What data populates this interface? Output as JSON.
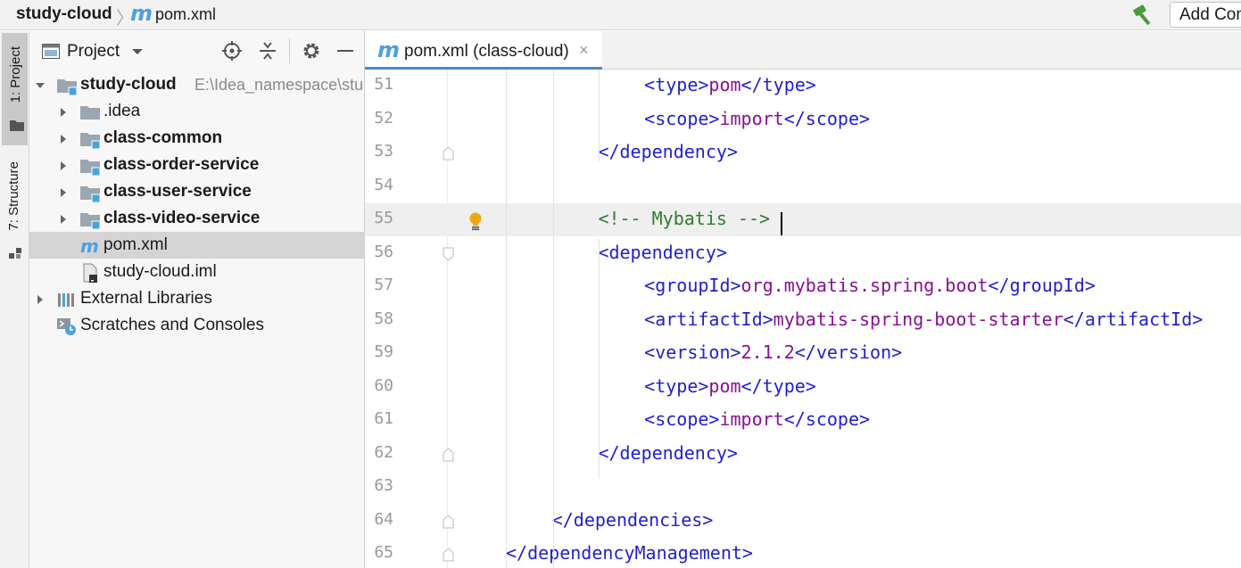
{
  "navbar": {
    "project_name": "study-cloud",
    "separator": "〉",
    "file_icon_letter": "m",
    "file_name": "pom.xml",
    "build_icon": "hammer-icon",
    "add_configuration_label": "Add Configuration..."
  },
  "tool_strip": {
    "project_tab": "1: Project",
    "structure_tab": "7: Structure"
  },
  "project_panel": {
    "title": "Project",
    "tree": [
      {
        "label": "study-cloud",
        "path": "E:\\Idea_namespace\\study-cloud",
        "bold": true,
        "expanded": true,
        "icon": "module-folder-icon"
      },
      {
        "label": ".idea",
        "bold": false,
        "expanded": false,
        "icon": "folder-icon"
      },
      {
        "label": "class-common",
        "bold": true,
        "expanded": false,
        "icon": "module-folder-icon"
      },
      {
        "label": "class-order-service",
        "bold": true,
        "expanded": false,
        "icon": "module-folder-icon"
      },
      {
        "label": "class-user-service",
        "bold": true,
        "expanded": false,
        "icon": "module-folder-icon"
      },
      {
        "label": "class-video-service",
        "bold": true,
        "expanded": false,
        "icon": "module-folder-icon"
      },
      {
        "label": "pom.xml",
        "bold": false,
        "selected": true,
        "icon": "maven-file-icon"
      },
      {
        "label": "study-cloud.iml",
        "bold": false,
        "icon": "iml-file-icon"
      },
      {
        "label": "External Libraries",
        "bold": false,
        "expanded": false,
        "icon": "libraries-icon"
      },
      {
        "label": "Scratches and Consoles",
        "bold": false,
        "icon": "scratches-icon"
      }
    ]
  },
  "editor": {
    "tab_label": "pom.xml (class-cloud)",
    "tab_close": "×",
    "current_line": 55,
    "lines": [
      {
        "n": "51",
        "text": "<type>pom</type>"
      },
      {
        "n": "52",
        "text": "<scope>import</scope>"
      },
      {
        "n": "53",
        "text": "</dependency>"
      },
      {
        "n": "54",
        "text": ""
      },
      {
        "n": "55",
        "text": "<!-- Mybatis -->"
      },
      {
        "n": "56",
        "text": "<dependency>"
      },
      {
        "n": "57",
        "text": "<groupId>org.mybatis.spring.boot</groupId>"
      },
      {
        "n": "58",
        "text": "<artifactId>mybatis-spring-boot-starter</artifactId>"
      },
      {
        "n": "59",
        "text": "<version>2.1.2</version>"
      },
      {
        "n": "60",
        "text": "<type>pom</type>"
      },
      {
        "n": "61",
        "text": "<scope>import</scope>"
      },
      {
        "n": "62",
        "text": "</dependency>"
      },
      {
        "n": "63",
        "text": ""
      },
      {
        "n": "64",
        "text": "</dependencies>"
      },
      {
        "n": "65",
        "text": "</dependencyManagement>"
      }
    ]
  },
  "colors": {
    "tag": "#1f1fd0",
    "text": "#871094",
    "comment": "#2f7d2f",
    "maven_accent": "#4e9fde",
    "tab_underline": "#4a88c7"
  }
}
